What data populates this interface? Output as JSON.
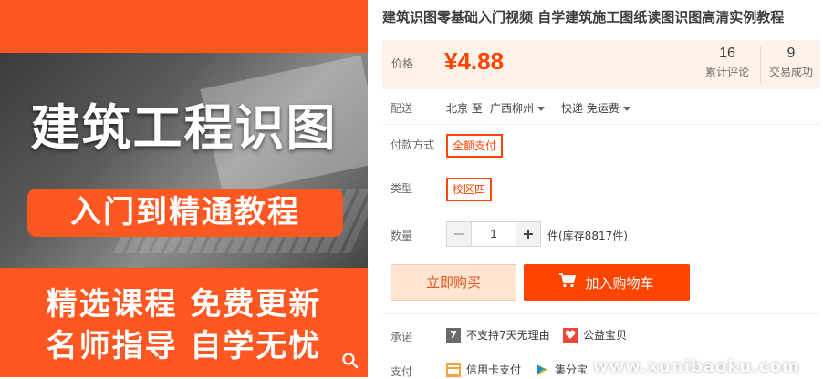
{
  "product": {
    "title": "建筑识图零基础入门视频 自学建筑施工图纸读图识图高清实例教程"
  },
  "hero_image": {
    "headline": "建筑工程识图",
    "pill_text": "入门到精通教程",
    "line1": "精选课程 免费更新",
    "line2": "名师指导 自学无忧"
  },
  "price": {
    "label": "价格",
    "value": "¥4.88"
  },
  "stats": {
    "reviews_count": "16",
    "reviews_label": "累计评论",
    "sales_count": "9",
    "sales_label": "交易成功"
  },
  "delivery": {
    "label": "配送",
    "from": "北京 至",
    "to": "广西柳州",
    "method": "快递 免运费"
  },
  "payment": {
    "label": "付款方式",
    "option": "全额支付"
  },
  "type": {
    "label": "类型",
    "option": "校区四"
  },
  "quantity": {
    "label": "数量",
    "value": "1",
    "stock_text": "件(库存8817件)"
  },
  "actions": {
    "buy_now": "立即购买",
    "add_to_cart": "加入购物车"
  },
  "promise": {
    "label": "承诺",
    "item1": "不支持7天无理由",
    "item2": "公益宝贝"
  },
  "pay_methods": {
    "label": "支付",
    "item1": "信用卡支付",
    "item2": "集分宝"
  },
  "watermark": "www.xunibaoku.com",
  "colors": {
    "accent": "#ff4400",
    "hero_orange": "#ff5722",
    "price_panel_bg": "#fff2e8",
    "buy_now_bg": "#ffe4d0"
  },
  "icons": {
    "zoom": "magnifier-icon",
    "cart": "cart-icon",
    "no_return": "seven-badge-icon",
    "charity": "heart-icon",
    "credit_card": "credit-card-icon",
    "jifenbao": "jifenbao-icon"
  }
}
